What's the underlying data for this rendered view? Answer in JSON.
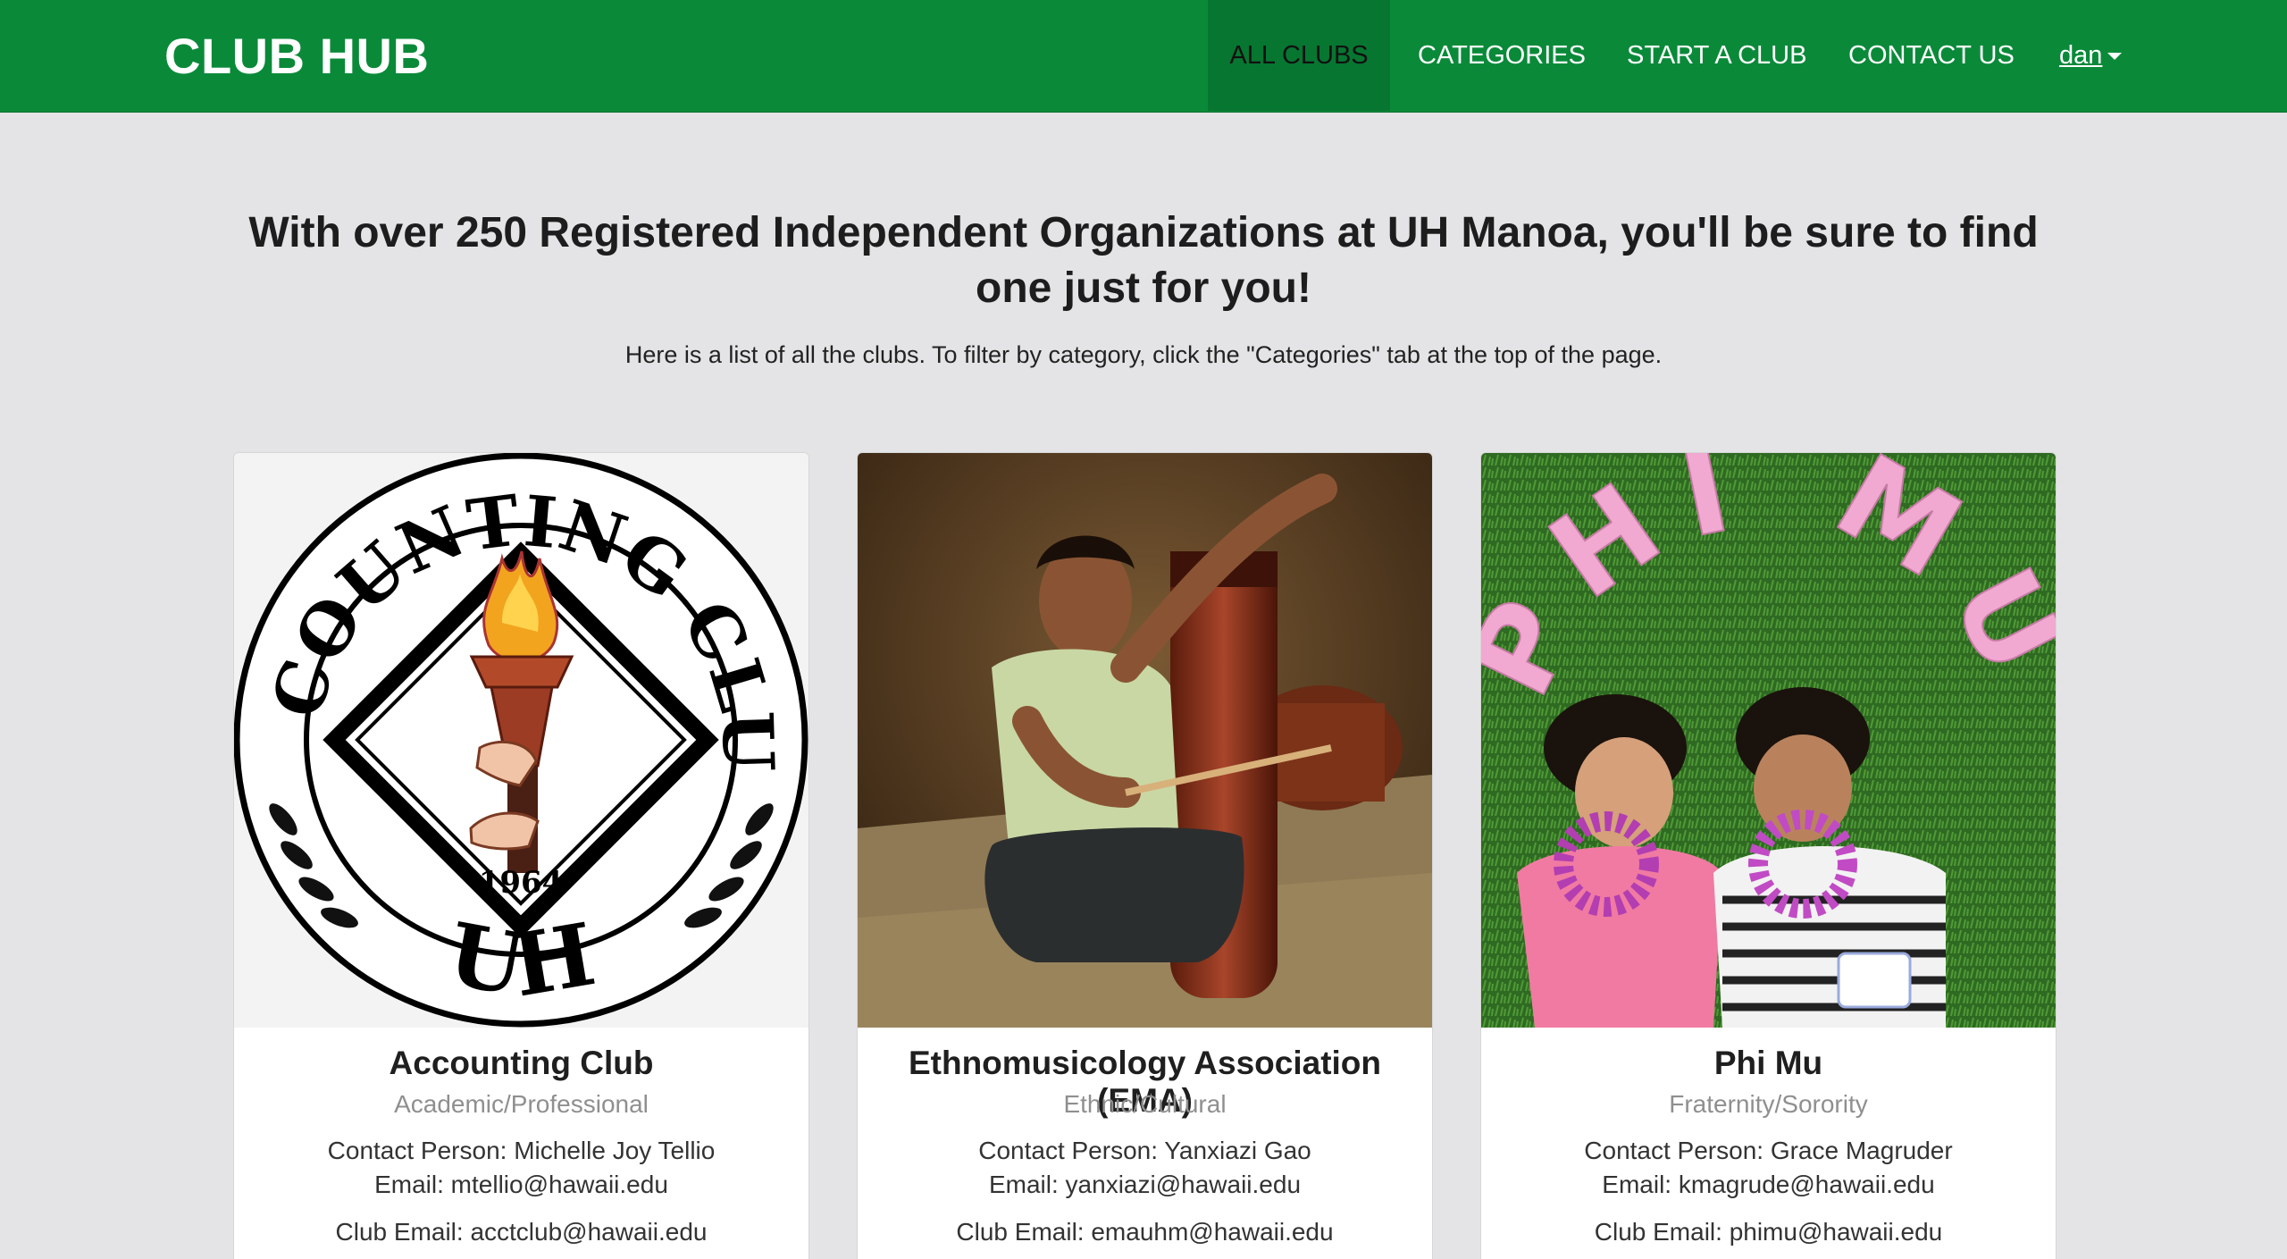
{
  "nav": {
    "brand": "CLUB HUB",
    "items": [
      "ALL CLUBS",
      "CATEGORIES",
      "START A CLUB",
      "CONTACT US"
    ],
    "user": "dan"
  },
  "intro": {
    "headline": "With over 250 Registered Independent Organizations at UH Manoa, you'll be sure to find one just for you!",
    "subtext": "Here is a list of all the clubs. To filter by category, click the \"Categories\" tab at the top of the page."
  },
  "clubs": [
    {
      "name": "Accounting Club",
      "category": "Academic/Professional",
      "contact": "Contact Person: Michelle Joy Tellio",
      "email": "Email: mtellio@hawaii.edu",
      "club_email": "Club Email: acctclub@hawaii.edu",
      "logo": {
        "ring_text": "ACCOUNTING CLUB",
        "bottom_text": "UH",
        "year": "1964"
      }
    },
    {
      "name": "Ethnomusicology Association (EMA)",
      "category": "Ethnic/Cultural",
      "contact": "Contact Person: Yanxiazi Gao",
      "email": "Email: yanxiazi@hawaii.edu",
      "club_email": "Club Email: emauhm@hawaii.edu"
    },
    {
      "name": "Phi Mu",
      "category": "Fraternity/Sorority",
      "contact": "Contact Person: Grace Magruder",
      "email": "Email: kmagrude@hawaii.edu",
      "club_email": "Club Email: phimu@hawaii.edu",
      "photo_text": "PHI MU"
    }
  ],
  "colors": {
    "navbar": "#0a8a39",
    "background": "#e4e4e6",
    "category": "#8f8f8f"
  }
}
